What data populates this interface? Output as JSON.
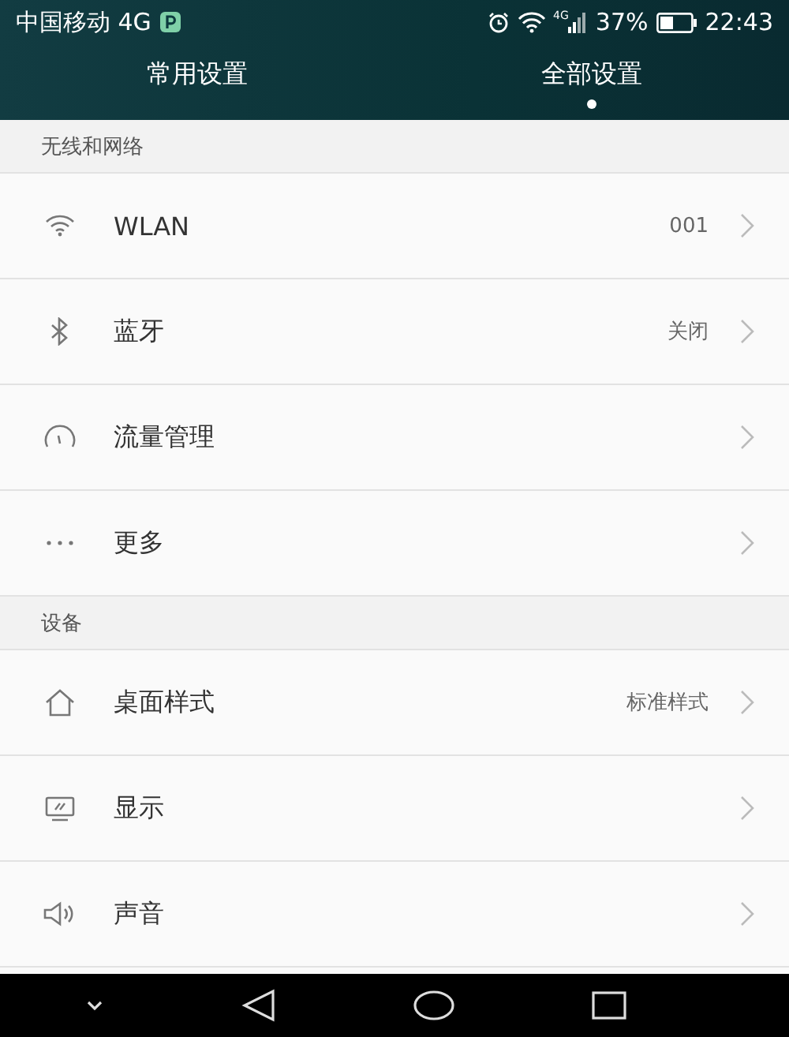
{
  "status_bar": {
    "carrier": "中国移动 4G",
    "network_type": "4G",
    "battery": "37%",
    "time": "22:43"
  },
  "tabs": [
    {
      "label": "常用设置",
      "selected": false
    },
    {
      "label": "全部设置",
      "selected": true
    }
  ],
  "sections": [
    {
      "title": "无线和网络",
      "items": [
        {
          "label": "WLAN",
          "value": "001"
        },
        {
          "label": "蓝牙",
          "value": "关闭"
        },
        {
          "label": "流量管理"
        },
        {
          "label": "更多"
        }
      ]
    },
    {
      "title": "设备",
      "items": [
        {
          "label": "桌面样式",
          "value": "标准样式"
        },
        {
          "label": "显示"
        },
        {
          "label": "声音"
        }
      ]
    }
  ]
}
